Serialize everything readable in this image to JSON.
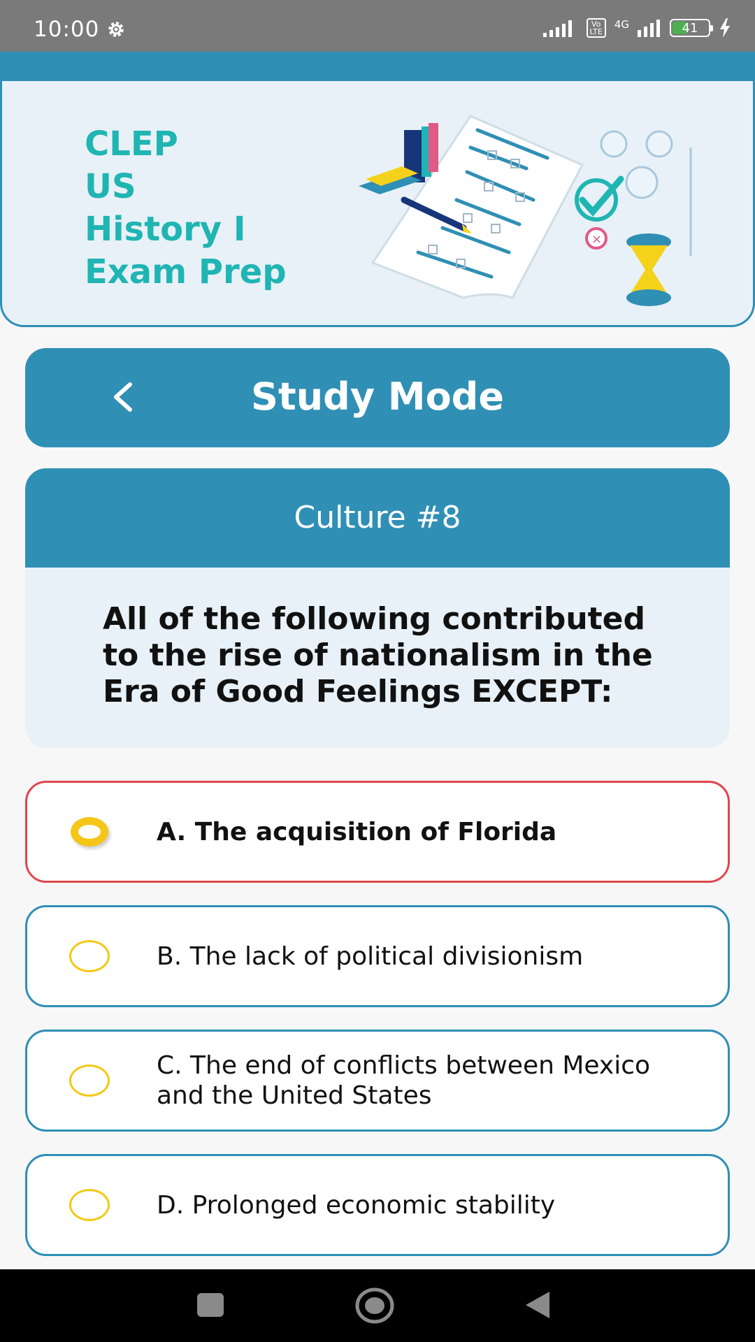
{
  "status_bar": {
    "time": "10:00",
    "network": "4G",
    "volte_top": "Vo",
    "volte_bottom": "LTE",
    "battery": "41",
    "battery_level": 0.41
  },
  "header": {
    "title_lines": [
      "CLEP",
      "US",
      "History I",
      "Exam Prep"
    ]
  },
  "toolbar": {
    "title": "Study Mode"
  },
  "question": {
    "heading": "Culture #8",
    "text": "All of the following contributed to the rise of nationalism in the Era of Good Feelings EXCEPT:"
  },
  "options": [
    {
      "label": "A. The acquisition of Florida",
      "selected": true
    },
    {
      "label": "B. The lack of political divisionism",
      "selected": false
    },
    {
      "label": "C. The end of conflicts between Mexico and the United States",
      "selected": false
    },
    {
      "label": "D. Prolonged economic stability",
      "selected": false
    }
  ],
  "colors": {
    "primary": "#2f8fb5",
    "title_teal": "#1fb5b3",
    "radio_yellow": "#f5c518",
    "selected_border": "#e0474c",
    "card_bg": "#e8f1f7"
  },
  "icons": {
    "back": "chevron-left-icon",
    "settings": "gear-icon",
    "nav_recent": "square-icon",
    "nav_home": "circle-icon",
    "nav_back": "triangle-icon"
  }
}
